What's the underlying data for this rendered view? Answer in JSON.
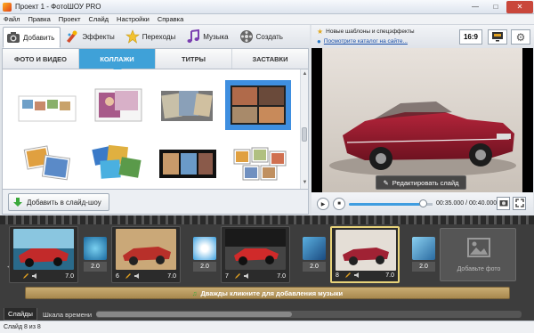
{
  "window": {
    "title": "Проект 1 - ФотоШОУ PRO"
  },
  "menu": [
    "Файл",
    "Правка",
    "Проект",
    "Слайд",
    "Настройки",
    "Справка"
  ],
  "toolbar": {
    "tabs": [
      {
        "label": "Добавить",
        "icon": "camera-icon",
        "active": true
      },
      {
        "label": "Эффекты",
        "icon": "palette-icon",
        "active": false
      },
      {
        "label": "Переходы",
        "icon": "star-icon",
        "active": false
      },
      {
        "label": "Музыка",
        "icon": "music-note-icon",
        "active": false
      },
      {
        "label": "Создать",
        "icon": "film-reel-icon",
        "active": false
      }
    ]
  },
  "sub_tabs": [
    {
      "label": "ФОТО И ВИДЕО",
      "active": false
    },
    {
      "label": "КОЛЛАЖИ",
      "active": true
    },
    {
      "label": "ТИТРЫ",
      "active": false
    },
    {
      "label": "ЗАСТАВКИ",
      "active": false
    }
  ],
  "gallery": {
    "selected_index": 3,
    "count": 8
  },
  "add_to_show_label": "Добавить в слайд-шоу",
  "info": {
    "news_label": "Новые шаблоны и спецэффекты",
    "catalog_link": "Посмотрите каталог на сайте..."
  },
  "ratio_label": "16:9",
  "preview": {
    "edit_button": "Редактировать слайд"
  },
  "player": {
    "time": "00:35.000 / 00:40.000",
    "progress": 0.875
  },
  "timeline": {
    "slides": [
      {
        "num": "",
        "duration": "7.0",
        "selected": false
      },
      {
        "num": "6",
        "duration": "7.0",
        "selected": false
      },
      {
        "num": "7",
        "duration": "7.0",
        "selected": false
      },
      {
        "num": "8",
        "duration": "7.0",
        "selected": true
      }
    ],
    "transitions": [
      "2.0",
      "2.0",
      "2.0",
      "2.0"
    ],
    "add_photo_label": "Добавьте фото",
    "music_hint": "Дважды кликните для добавления музыки"
  },
  "bottom_tabs": [
    {
      "label": "Слайды",
      "active": true
    },
    {
      "label": "Шкала времени",
      "active": false
    }
  ],
  "status": "Слайд 8 из 8",
  "colors": {
    "accent": "#3fa1d8",
    "selected_slide": "#e8d37a",
    "music_bar": "#b89a5e"
  }
}
